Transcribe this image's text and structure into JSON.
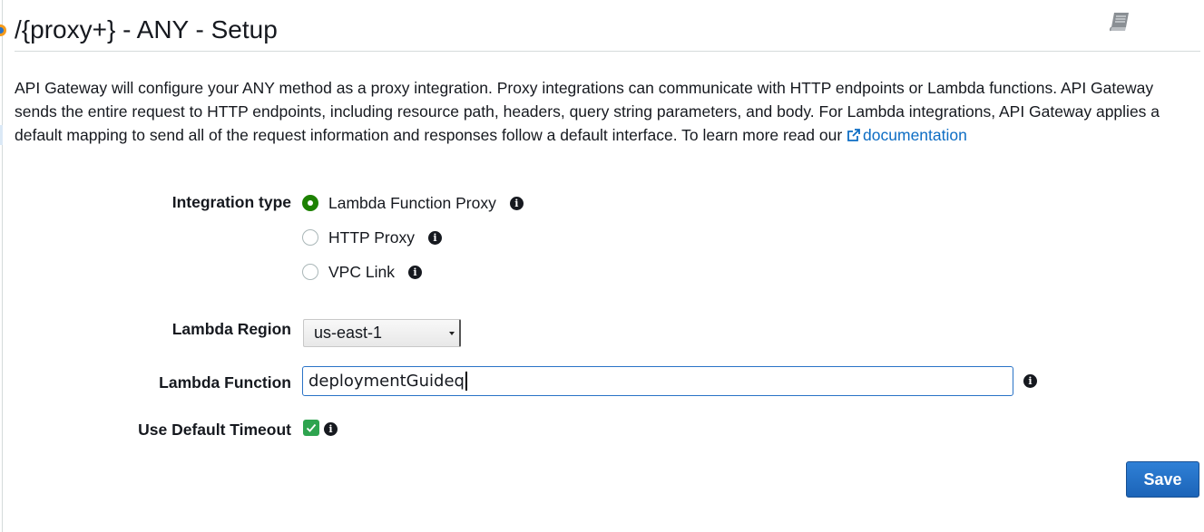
{
  "header": {
    "title": "/{proxy+} - ANY - Setup",
    "help_icon": "book-icon",
    "status_icon": "status-dot-icon"
  },
  "description": {
    "text": "API Gateway will configure your ANY method as a proxy integration. Proxy integrations can communicate with HTTP endpoints or Lambda functions. API Gateway sends the entire request to HTTP endpoints, including resource path, headers, query string parameters, and body. For Lambda integrations, API Gateway applies a default mapping to send all of the request information and responses follow a default interface. To learn more read our ",
    "link_label": "documentation",
    "link_icon": "external-link-icon"
  },
  "form": {
    "integration_type": {
      "label": "Integration type",
      "options": [
        {
          "label": "Lambda Function Proxy",
          "selected": true
        },
        {
          "label": "HTTP Proxy",
          "selected": false
        },
        {
          "label": "VPC Link",
          "selected": false
        }
      ]
    },
    "lambda_region": {
      "label": "Lambda Region",
      "value": "us-east-1"
    },
    "lambda_function": {
      "label": "Lambda Function",
      "value": "deploymentGuideq"
    },
    "default_timeout": {
      "label": "Use Default Timeout",
      "checked": true
    }
  },
  "actions": {
    "save_label": "Save"
  },
  "colors": {
    "accent_blue": "#2a73c7",
    "link_blue": "#0d6dc4",
    "selected_green": "#1d8102",
    "checkbox_green": "#2ea44f",
    "status_orange": "#f59b1c"
  }
}
